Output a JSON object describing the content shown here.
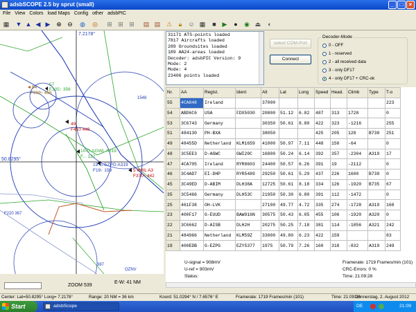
{
  "window": {
    "title": "adsbSCOPE 2.5  by sprut  (small)"
  },
  "menu": [
    "File",
    "View",
    "Colors",
    "load Maps",
    "Config",
    "other",
    "adsbPIC"
  ],
  "toolbar_icons": [
    "grid-icon",
    "arrow-down-icon",
    "arrow-up-icon",
    "arrow-left-icon",
    "arrow-right-icon",
    "zoom-in-icon",
    "zoom-out-icon",
    "globe-icon",
    "target-icon",
    "network-icon",
    "network-icon",
    "network-icon",
    "chart-icon",
    "chart-icon",
    "warning-icon",
    "lock-icon",
    "person-icon",
    "grid-icon",
    "square-icon",
    "play-icon",
    "stop-icon",
    "record-icon",
    "eject-icon",
    "circle-icon"
  ],
  "map": {
    "coord_top": "7.2178°",
    "coord_left": "50.8295°",
    "zoom_label": "ZOOM 539",
    "scale_label": "E-W: 41 NM",
    "aircraft": [
      {
        "label1": "54",
        "label2": "F209↑ 455"
      },
      {
        "label1": "57",
        "label2": "F105↑ 356"
      },
      {
        "label1": "49",
        "label2": "F410  448"
      },
      {
        "label1": "10-D-AGWL A319",
        "label2": "F... 122"
      },
      {
        "label1": "19 G-EZPG A319",
        "label2": "F19↑ 159"
      },
      {
        "label1": "5 I80IL A3",
        "label2": "F370↑ 442"
      },
      {
        "label1": "26",
        "label2": ""
      }
    ],
    "labels": [
      "1548",
      "F220  367",
      "387",
      "OZNV",
      "F1"
    ]
  },
  "log": {
    "lines": [
      "31171 ATS-points loaded",
      "7817 Aircrafts loaded",
      "289 Groundsites loaded",
      "189 AA24-areas loaded",
      "Decoder: adsbPIC Version: 9",
      "Mode: 2",
      "Mode: 4",
      "23406 points loaded"
    ]
  },
  "buttons": {
    "select_com": "select COM-Port",
    "connect": "Connect"
  },
  "decoder": {
    "label": "Decoder-Mode",
    "options": [
      "0 - OFF",
      "1 - reserved",
      "2 - all received data",
      "3 - only DF17",
      "4 - only DF17 + CRC-ok"
    ],
    "selected": 4
  },
  "table": {
    "headers": [
      "Nr.",
      "AA",
      "Regist.",
      "Ident",
      "Alt",
      "Lat",
      "Long",
      "Speed",
      "Head.",
      "Climb",
      "Type",
      "T-o"
    ],
    "rows": [
      [
        "55",
        "4CA848",
        "Ireland",
        "",
        "37000",
        "",
        "",
        "",
        "",
        "",
        "",
        "223"
      ],
      [
        "54",
        "ABD6C6",
        "USA",
        "FDX5030",
        "20800",
        "51.12",
        "6.82",
        "487",
        "313",
        "1728",
        "",
        "0"
      ],
      [
        "53",
        "3C6743",
        "Germany",
        "",
        "30350",
        "50.61",
        "8.80",
        "422",
        "323",
        "-1216",
        "",
        "255"
      ],
      [
        "51",
        "484130",
        "PH-BXA",
        "",
        "38050",
        "",
        "",
        "425",
        "205",
        "128",
        "B738",
        "251"
      ],
      [
        "49",
        "48455D",
        "Netherland",
        "KLM1659",
        "41000",
        "50.97",
        "7.11",
        "448",
        "150",
        "-64",
        "",
        "0"
      ],
      [
        "48",
        "3C5EE3",
        "D-AGWC",
        "GWI20C",
        "16800",
        "50.24",
        "6.14",
        "392",
        "357",
        "-2304",
        "A319",
        "17"
      ],
      [
        "47",
        "4CA705",
        "Ireland",
        "RYR8603",
        "24400",
        "50.57",
        "6.26",
        "391",
        "19",
        "-2112",
        "",
        "0"
      ],
      [
        "46",
        "3C4AD7",
        "EI-DHP",
        "RYR5489",
        "29250",
        "50.61",
        "5.29",
        "437",
        "226",
        "1600",
        "B738",
        "0"
      ],
      [
        "45",
        "3C49ED",
        "D-ABIM",
        "DLH38A",
        "12725",
        "50.61",
        "8.18",
        "334",
        "126",
        "-1920",
        "B735",
        "67"
      ],
      [
        "35",
        "3C5466",
        "Germany",
        "DLH53C",
        "21950",
        "50.30",
        "6.80",
        "391",
        "112",
        "-1472",
        "",
        "0"
      ],
      [
        "25",
        "461F38",
        "OH-LVK",
        "",
        "27100",
        "49.77",
        "4.72",
        "335",
        "274",
        "-1728",
        "A319",
        "168"
      ],
      [
        "23",
        "400F17",
        "G-EUUD",
        "BAW916N",
        "30575",
        "50.43",
        "6.05",
        "455",
        "106",
        "-1920",
        "A320",
        "0"
      ],
      [
        "22",
        "3C6662",
        "D-AISB",
        "DLH2H",
        "20275",
        "50.25",
        "7.18",
        "381",
        "114",
        "-1856",
        "A321",
        "242"
      ],
      [
        "21",
        "484966",
        "Netherland",
        "KLM59Z",
        "33000",
        "49.80",
        "6.23",
        "422",
        "159",
        "",
        "",
        "83"
      ],
      [
        "19",
        "400EDB",
        "G-EZPG",
        "EZY5377",
        "1975",
        "50.79",
        "7.26",
        "160",
        "318",
        "-832",
        "A319",
        "249"
      ]
    ]
  },
  "signal": {
    "u_signal": "U-signal = 908mV",
    "u_ref": "U-ref = 903mV",
    "status": "Status:"
  },
  "stats": {
    "framerate": "Framerate:   1719 Frames/min (101)",
    "crc": "CRC-Errors: 0 %",
    "time": "Time: 21:09:28"
  },
  "statusbar": {
    "center": "Center: Lat=50.8295° Long= 7.2178°",
    "range": "Range: 20 NM = 36 km",
    "koord": "Koord: 51.0294° N / 7.6576° E",
    "framerate": "Framerate:    1719 Frames/min (101)",
    "time": "Time: 21:09:28",
    "date": "Donnerstag, 2. August 2012"
  },
  "taskbar": {
    "start": "Start",
    "task": "adsbScope",
    "lang": "DE",
    "clock": "21:09"
  },
  "colors": {
    "accent": "#316ac5",
    "map_blue": "#1f3bb5",
    "map_green": "#2aa52a",
    "aircraft_red": "#c00000"
  }
}
